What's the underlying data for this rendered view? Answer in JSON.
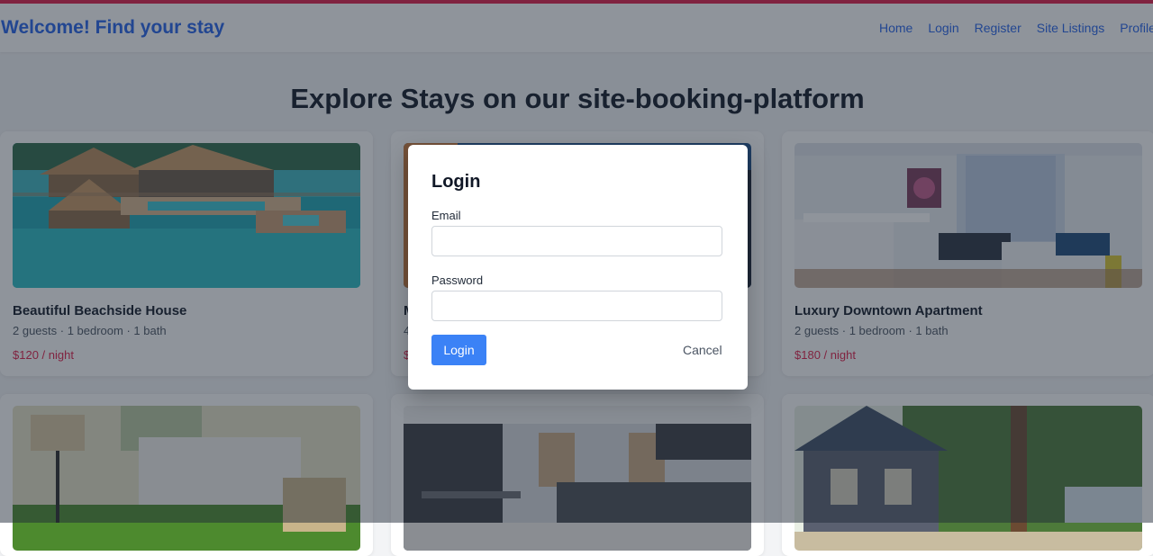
{
  "brand": "Welcome! Find your stay",
  "nav": [
    "Home",
    "Login",
    "Register",
    "Site Listings",
    "Profile"
  ],
  "heading": "Explore Stays on our site-booking-platform",
  "listings": [
    {
      "title": "Beautiful Beachside House",
      "details": "2 guests · 1 bedroom · 1 bath",
      "price": "$120 / night",
      "image": "overwater-villa"
    },
    {
      "title": "M",
      "details": "4",
      "price": "$",
      "image": "city-skyline"
    },
    {
      "title": "Luxury Downtown Apartment",
      "details": "2 guests · 1 bedroom · 1 bath",
      "price": "$180 / night",
      "image": "living-room"
    },
    {
      "image": "bedroom"
    },
    {
      "image": "modern-kitchen"
    },
    {
      "image": "lakeside-cabin"
    }
  ],
  "modal": {
    "title": "Login",
    "email_label": "Email",
    "email_value": "",
    "password_label": "Password",
    "password_value": "",
    "submit_label": "Login",
    "cancel_label": "Cancel"
  },
  "colors": {
    "accent": "#e11d48",
    "brand": "#2563eb",
    "primary_button": "#3b82f6",
    "price": "#e11d48"
  }
}
